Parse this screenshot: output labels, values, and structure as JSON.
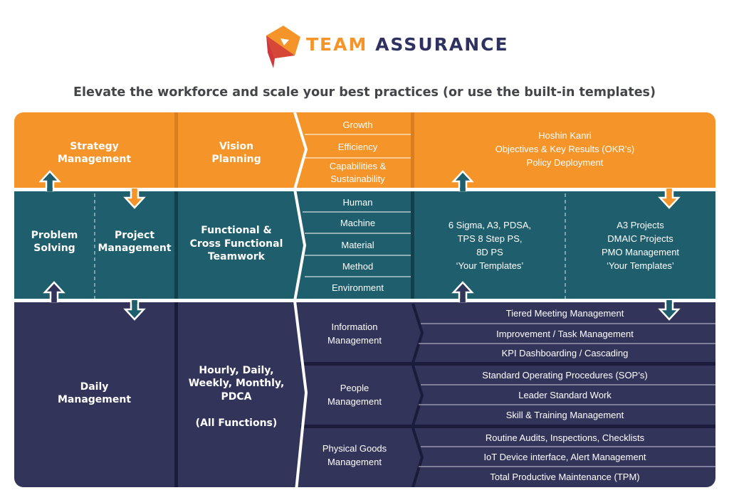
{
  "brand": {
    "name_part1": "TEAM",
    "name_part2": "ASSURANCE",
    "logo_icon": "pentagon-flag-logo-icon",
    "colors": {
      "orange": "#f59428",
      "red": "#d0393a",
      "navy": "#2f3260"
    }
  },
  "subtitle": "Elevate the workforce and scale your best practices (or use the built-in templates)",
  "colors": {
    "strategy_row": "#f59428",
    "functional_row": "#1f5e6c",
    "daily_row": "#33345a",
    "divider_white": "#ffffff"
  },
  "rows": {
    "strategy": {
      "label": "Strategy\nManagement",
      "cadence": "Vision\nPlanning",
      "focus_items": [
        "Growth",
        "Efficiency",
        "Capabilities &\nSustainability"
      ],
      "methods": "Hoshin Kanri\nObjectives & Key Results (OKR’s)\nPolicy Deployment"
    },
    "functional": {
      "label_left": "Problem\nSolving",
      "label_right": "Project\nManagement",
      "cadence": "Functional &\nCross Functional\nTeamwork",
      "focus_items": [
        "Human",
        "Machine",
        "Material",
        "Method",
        "Environment"
      ],
      "methods_left": "6 Sigma, A3, PDSA,\nTPS 8 Step PS,\n8D PS\n‘Your Templates’",
      "methods_right": "A3 Projects\nDMAIC Projects\nPMO Management\n‘Your Templates’"
    },
    "daily": {
      "label": "Daily\nManagement",
      "cadence": "Hourly, Daily,\nWeekly, Monthly,\nPDCA\n\n(All Functions)",
      "groups": [
        {
          "name": "Information\nManagement",
          "items": [
            "Tiered Meeting Management",
            "Improvement / Task Management",
            "KPI Dashboarding / Cascading"
          ]
        },
        {
          "name": "People\nManagement",
          "items": [
            "Standard Operating Procedures (SOP’s)",
            "Leader Standard Work",
            "Skill & Training Management"
          ]
        },
        {
          "name": "Physical Goods\nManagement",
          "items": [
            "Routine Audits, Inspections, Checklists",
            "IoT Device interface, Alert Management",
            "Total Productive Maintenance (TPM)"
          ]
        }
      ]
    }
  },
  "arrows": [
    {
      "name": "problem-solving-up-arrow-icon",
      "direction": "up"
    },
    {
      "name": "project-management-down-arrow-icon",
      "direction": "down"
    },
    {
      "name": "daily-to-problem-solving-up-arrow-icon",
      "direction": "up"
    },
    {
      "name": "project-to-daily-down-arrow-icon",
      "direction": "down"
    },
    {
      "name": "methods-up-arrow-icon",
      "direction": "up"
    },
    {
      "name": "okr-down-arrow-icon",
      "direction": "down"
    },
    {
      "name": "daily-to-methods-up-arrow-icon",
      "direction": "up"
    },
    {
      "name": "projects-to-daily-down-arrow-icon",
      "direction": "down"
    }
  ]
}
